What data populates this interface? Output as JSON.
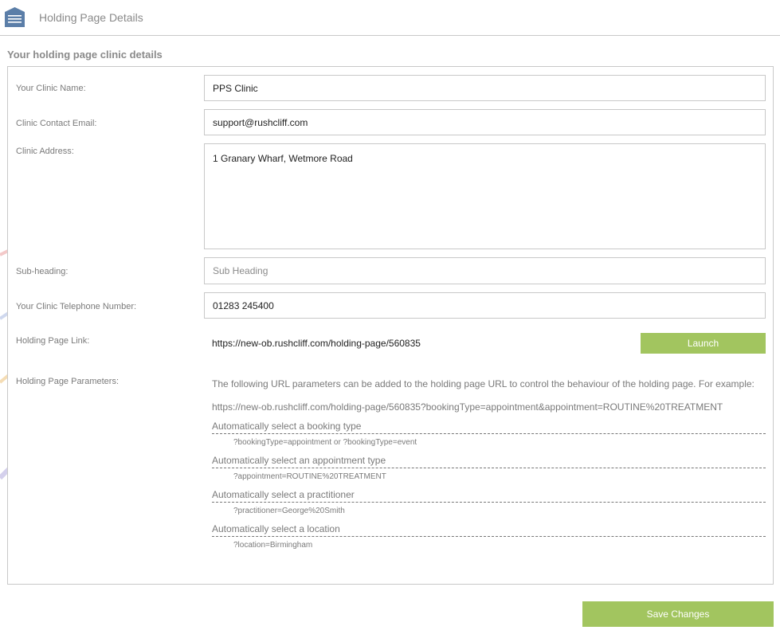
{
  "header": {
    "title": "Holding Page Details",
    "menu_icon": "hamburger-menu-icon"
  },
  "section": {
    "heading": "Your holding page clinic details"
  },
  "form": {
    "clinic_name": {
      "label": "Your Clinic Name:",
      "value": "PPS Clinic"
    },
    "contact_email": {
      "label": "Clinic Contact Email:",
      "value": "support@rushcliff.com"
    },
    "address": {
      "label": "Clinic Address:",
      "value": "1 Granary Wharf, Wetmore Road"
    },
    "subheading": {
      "label": "Sub-heading:",
      "value": "",
      "placeholder": "Sub Heading"
    },
    "telephone": {
      "label": "Your Clinic Telephone Number:",
      "value": "01283 245400"
    },
    "link": {
      "label": "Holding Page Link:",
      "value": "https://new-ob.rushcliff.com/holding-page/560835",
      "button": "Launch"
    },
    "parameters": {
      "label": "Holding Page Parameters:",
      "intro": "The following URL parameters can be added to the holding page URL to control the behaviour of the holding page. For example:",
      "example": "https://new-ob.rushcliff.com/holding-page/560835?bookingType=appointment&appointment=ROUTINE%20TREATMENT",
      "items": [
        {
          "title": "Automatically select a booking type",
          "code": "?bookingType=appointment or ?bookingType=event"
        },
        {
          "title": "Automatically select an appointment type",
          "code": "?appointment=ROUTINE%20TREATMENT"
        },
        {
          "title": "Automatically select a practitioner",
          "code": "?practitioner=George%20Smith"
        },
        {
          "title": "Automatically select a location",
          "code": "?location=Birmingham"
        }
      ]
    }
  },
  "actions": {
    "save_label": "Save Changes"
  },
  "colors": {
    "accent_green": "#a2c55f",
    "menu_icon_blue": "#5b7ea8",
    "label_grey": "#7a7a7a"
  }
}
